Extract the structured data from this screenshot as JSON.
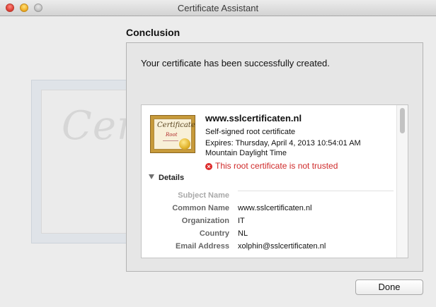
{
  "window": {
    "title": "Certificate Assistant"
  },
  "page": {
    "heading": "Conclusion",
    "message": "Your certificate has been successfully created."
  },
  "watermark": {
    "text": "Certific"
  },
  "certificate": {
    "icon_word": "Certificate",
    "icon_root": "Root",
    "name": "www.sslcertificaten.nl",
    "type": "Self-signed root certificate",
    "expires": "Expires: Thursday, April 4, 2013 10:54:01 AM",
    "timezone": "Mountain Daylight Time",
    "warning": "This root certificate is not trusted",
    "warning_icon": "error-x-icon"
  },
  "details": {
    "toggle_label": "Details",
    "section_label": "Subject Name",
    "fields": [
      {
        "label": "Common Name",
        "value": "www.sslcertificaten.nl"
      },
      {
        "label": "Organization",
        "value": "IT"
      },
      {
        "label": "Country",
        "value": "NL"
      },
      {
        "label": "Email Address",
        "value": "xolphin@sslcertificaten.nl"
      }
    ]
  },
  "buttons": {
    "done": "Done"
  },
  "colors": {
    "warning": "#cf2a2a",
    "background": "#ececec"
  }
}
